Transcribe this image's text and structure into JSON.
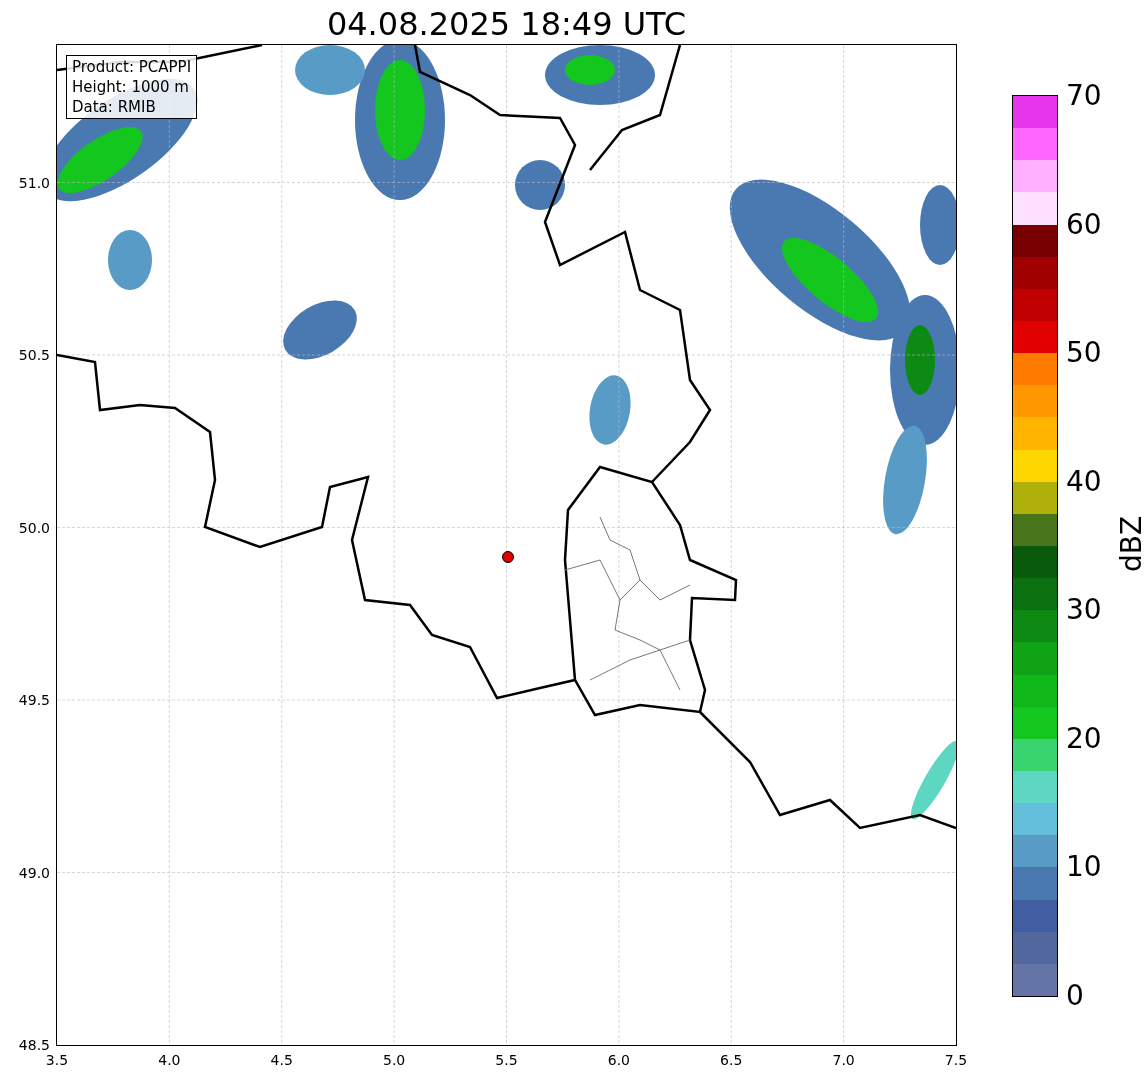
{
  "title": "04.08.2025 18:49 UTC",
  "map": {
    "info": [
      "Product: PCAPPI",
      "Height: 1000 m",
      "Data: RMIB"
    ],
    "x_ticks": [
      "3.5",
      "4.0",
      "4.5",
      "5.0",
      "5.5",
      "6.0",
      "6.5",
      "7.0",
      "7.5"
    ],
    "y_ticks": [
      "51.0",
      "50.5",
      "50.0",
      "49.5",
      "49.0",
      "48.5"
    ]
  },
  "colorbar": {
    "label": "dBZ",
    "ticks": [
      "70",
      "60",
      "50",
      "40",
      "30",
      "20",
      "10",
      "0"
    ],
    "bands": [
      {
        "color": "#6474a6"
      },
      {
        "color": "#52679d"
      },
      {
        "color": "#425ea2"
      },
      {
        "color": "#4a79b2"
      },
      {
        "color": "#589bc6"
      },
      {
        "color": "#63bfdc"
      },
      {
        "color": "#5dd6c2"
      },
      {
        "color": "#3ad46f"
      },
      {
        "color": "#13c71f"
      },
      {
        "color": "#10b719"
      },
      {
        "color": "#0fa315"
      },
      {
        "color": "#0d8a13"
      },
      {
        "color": "#0b7110"
      },
      {
        "color": "#095a0b"
      },
      {
        "color": "#48751a"
      },
      {
        "color": "#b0b00b"
      },
      {
        "color": "#ffd700"
      },
      {
        "color": "#ffb400"
      },
      {
        "color": "#ff9800"
      },
      {
        "color": "#ff7b00"
      },
      {
        "color": "#e00000"
      },
      {
        "color": "#c00000"
      },
      {
        "color": "#a00000"
      },
      {
        "color": "#780000"
      },
      {
        "color": "#ffe0ff"
      },
      {
        "color": "#ffb0ff"
      },
      {
        "color": "#ff66ff"
      },
      {
        "color": "#e636eb"
      }
    ]
  }
}
